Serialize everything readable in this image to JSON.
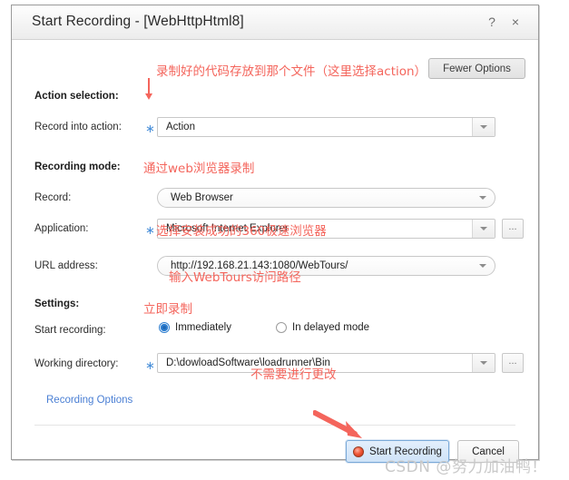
{
  "dialog": {
    "title": "Start Recording - [WebHttpHtml8]",
    "help_icon": "?",
    "close_icon": "×",
    "fewer_options_label": "Fewer Options"
  },
  "groups": {
    "action_selection": "Action selection:",
    "recording_mode": "Recording mode:",
    "settings": "Settings:"
  },
  "fields": {
    "record_into_action": {
      "label": "Record into action:",
      "required_marker": "∗",
      "value": "Action"
    },
    "record": {
      "label": "Record:",
      "value": "Web Browser"
    },
    "application": {
      "label": "Application:",
      "required_marker": "∗",
      "value": "Microsoft Internet Explorer",
      "browse_label": "..."
    },
    "url_address": {
      "label": "URL address:",
      "value": "http://192.168.21.143:1080/WebTours/"
    },
    "start_recording": {
      "label": "Start recording:",
      "option_immediately": "Immediately",
      "option_delayed": "In delayed mode",
      "selected": "Immediately"
    },
    "working_directory": {
      "label": "Working directory:",
      "required_marker": "∗",
      "value": "D:\\dowloadSoftware\\loadrunner\\Bin",
      "browse_label": "..."
    }
  },
  "links": {
    "recording_options": "Recording Options"
  },
  "footer": {
    "start_recording": "Start Recording",
    "cancel": "Cancel"
  },
  "annotations": {
    "action_note": "录制好的代码存放到那个文件（这里选择action）",
    "record_note": "通过web浏览器录制",
    "application_note": "选择安装成功的360极速浏览器",
    "url_note": "输入WebTours访问路径",
    "start_note": "立即录制",
    "workdir_note": "不需要进行更改"
  },
  "watermark": "CSDN @努力加油鸭！",
  "colors": {
    "annotation": "#f4655c",
    "link": "#4a7fd4",
    "required_star": "#4a90d9",
    "primary_button_bg": "#cfe3f8",
    "record_icon": "#f0593a"
  }
}
